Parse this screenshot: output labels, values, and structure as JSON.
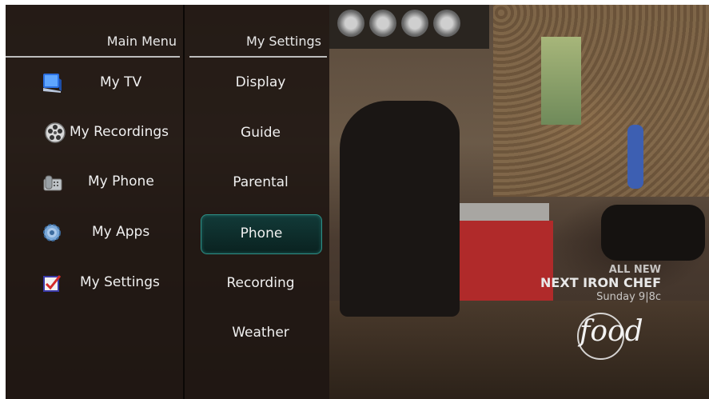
{
  "main_menu": {
    "title": "Main Menu",
    "items": [
      {
        "label": "My TV",
        "icon": "tv-icon"
      },
      {
        "label": "My Recordings",
        "icon": "film-reel-icon"
      },
      {
        "label": "My Phone",
        "icon": "phone-icon"
      },
      {
        "label": "My Apps",
        "icon": "gear-icon"
      },
      {
        "label": "My Settings",
        "icon": "checkbox-icon"
      }
    ]
  },
  "settings_menu": {
    "title": "My Settings",
    "selected": "Phone",
    "items": [
      {
        "label": "Display"
      },
      {
        "label": "Guide"
      },
      {
        "label": "Parental"
      },
      {
        "label": "Phone"
      },
      {
        "label": "Recording"
      },
      {
        "label": "Weather"
      }
    ]
  },
  "overlay_promo": {
    "line1": "ALL NEW",
    "line2": "NEXT IRON CHEF",
    "line3": "Sunday 9|8c",
    "network_logo": "food"
  },
  "colors": {
    "selection_border": "#2d8f86",
    "selection_fill": "#123a38",
    "menu_text": "#f0f0f0"
  }
}
